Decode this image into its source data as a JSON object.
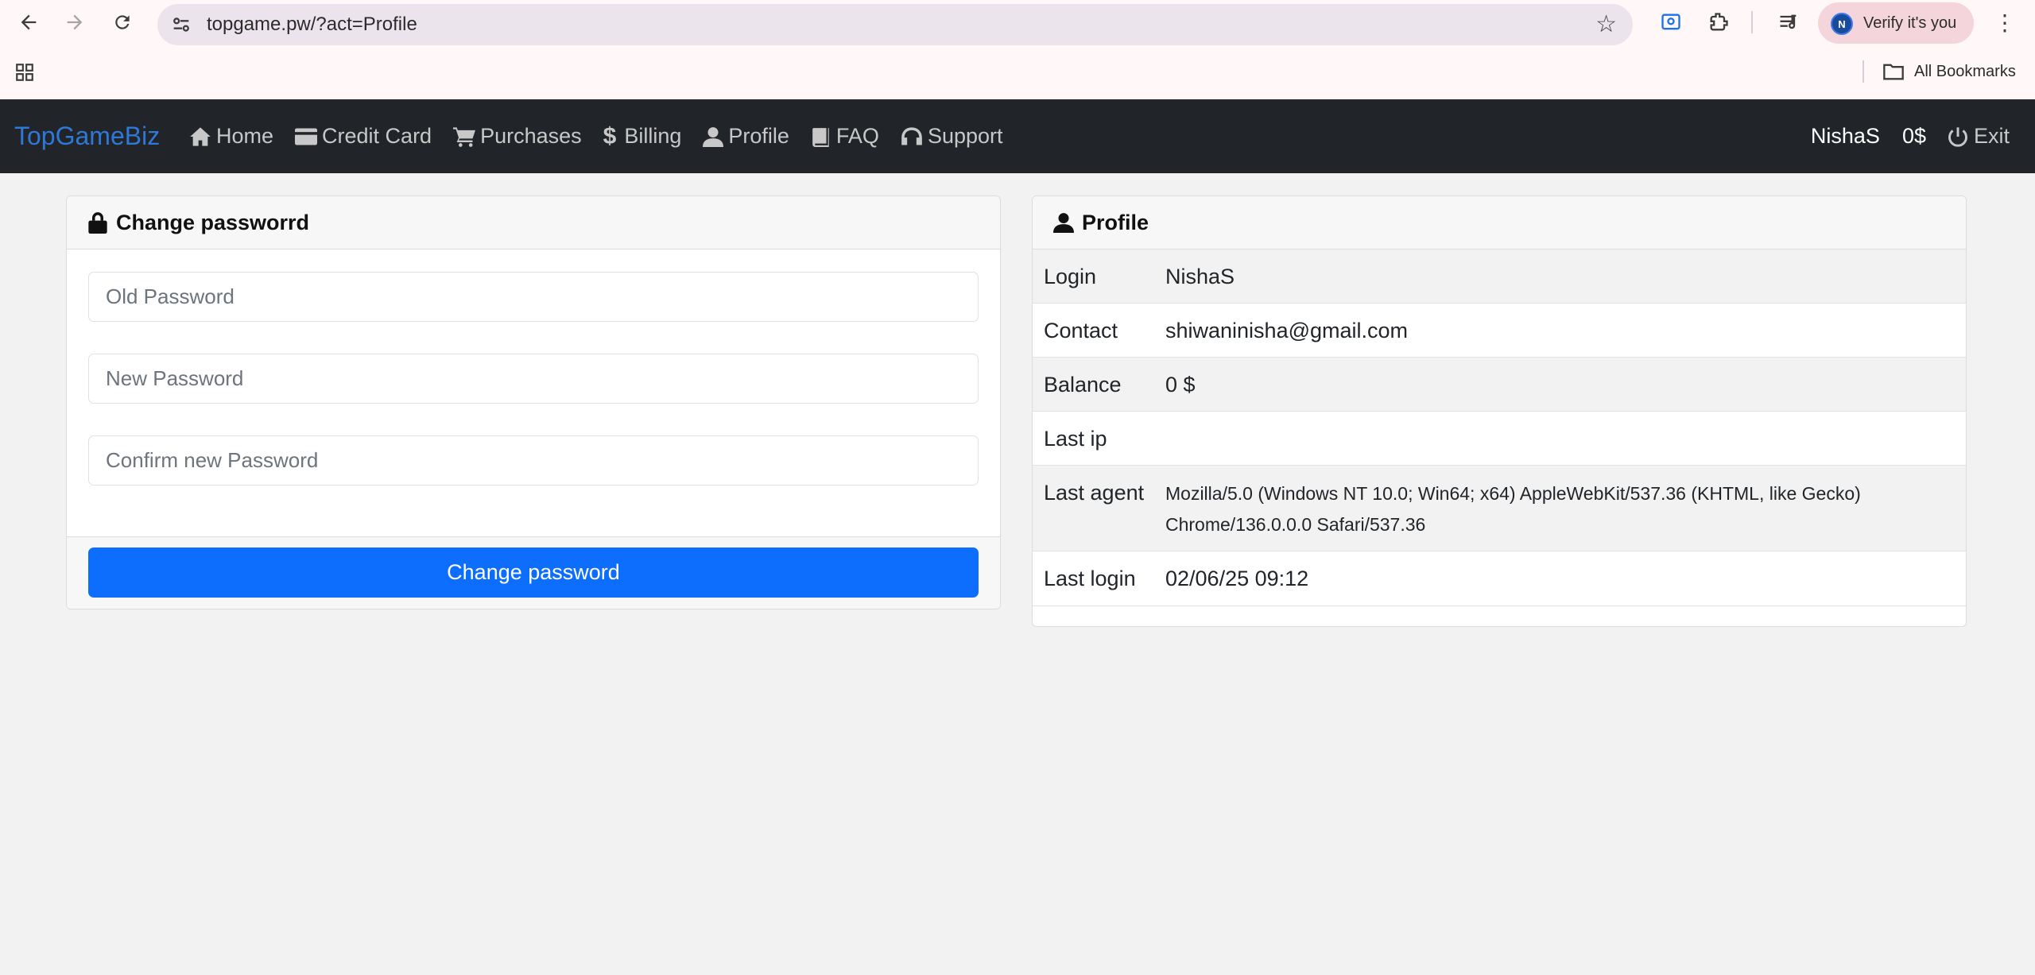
{
  "browser": {
    "url": "topgame.pw/?act=Profile",
    "profile_initial": "N",
    "profile_label": "Verify it's you",
    "bookmarks_label": "All Bookmarks"
  },
  "navbar": {
    "brand": "TopGameBiz",
    "links": [
      {
        "label": "Home",
        "icon": "home-icon"
      },
      {
        "label": "Credit Card",
        "icon": "credit-card-icon"
      },
      {
        "label": "Purchases",
        "icon": "cart-icon"
      },
      {
        "label": "Billing",
        "icon": "dollar-icon"
      },
      {
        "label": "Profile",
        "icon": "user-icon"
      },
      {
        "label": "FAQ",
        "icon": "book-icon"
      },
      {
        "label": "Support",
        "icon": "headphones-icon"
      }
    ],
    "username": "NishaS",
    "balance": "0$",
    "exit_label": "Exit"
  },
  "change_password": {
    "title": "Change passworrd",
    "old_placeholder": "Old Password",
    "new_placeholder": "New Password",
    "confirm_placeholder": "Confirm new Password",
    "submit_label": "Change password"
  },
  "profile": {
    "title": "Profile",
    "rows": [
      {
        "label": "Login",
        "value": "NishaS"
      },
      {
        "label": "Contact",
        "value": "shiwaninisha@gmail.com"
      },
      {
        "label": "Balance",
        "value": "0 $"
      },
      {
        "label": "Last ip",
        "value": ""
      },
      {
        "label": "Last agent",
        "value": "Mozilla/5.0 (Windows NT 10.0; Win64; x64) AppleWebKit/537.36 (KHTML, like Gecko) Chrome/136.0.0.0 Safari/537.36"
      },
      {
        "label": "Last login",
        "value": "02/06/25 09:12"
      }
    ]
  },
  "colors": {
    "navbar_bg": "#212529",
    "brand": "#2f78d8",
    "primary_button": "#0d6efd",
    "page_bg": "#f2f2f2"
  }
}
